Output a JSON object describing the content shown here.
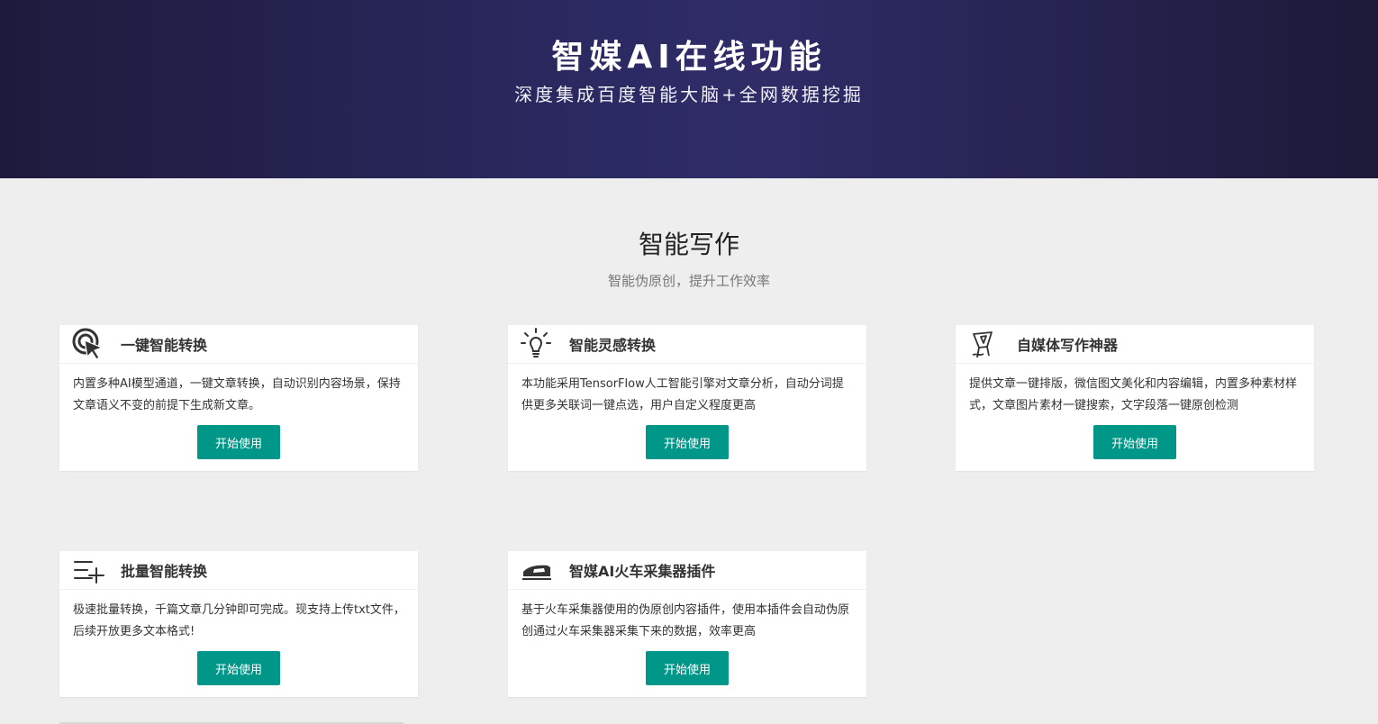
{
  "hero": {
    "title": "智媒AI在线功能",
    "subtitle": "深度集成百度智能大脑+全网数据挖掘"
  },
  "section": {
    "title": "智能写作",
    "subtitle": "智能伪原创，提升工作效率"
  },
  "colors": {
    "accent": "#009688",
    "hero_bg": "#2c2a63",
    "page_bg": "#eeeeee"
  },
  "cards": [
    {
      "icon": "cursor-click-icon",
      "title": "一键智能转换",
      "desc": "内置多种AI模型通道，一键文章转换，自动识别内容场景，保持文章语义不变的前提下生成新文章。",
      "button": "开始使用"
    },
    {
      "icon": "lightbulb-icon",
      "title": "智能灵感转换",
      "desc": "本功能采用TensorFlow人工智能引擎对文章分析，自动分词提供更多关联词一键点选，用户自定义程度更高",
      "button": "开始使用"
    },
    {
      "icon": "pen-cup-icon",
      "title": "自媒体写作神器",
      "desc": "提供文章一键排版，微信图文美化和内容编辑，内置多种素材样式，文章图片素材一键搜索，文字段落一键原创检测",
      "button": "开始使用"
    },
    {
      "icon": "list-add-icon",
      "title": "批量智能转换",
      "desc": "极速批量转换，千篇文章几分钟即可完成。现支持上传txt文件，后续开放更多文本格式!",
      "button": "开始使用"
    },
    {
      "icon": "train-icon",
      "title": "智媒AI火车采集器插件",
      "desc": "基于火车采集器使用的伪原创内容插件，使用本插件会自动伪原创通过火车采集器采集下来的数据，效率更高",
      "button": "开始使用"
    }
  ]
}
